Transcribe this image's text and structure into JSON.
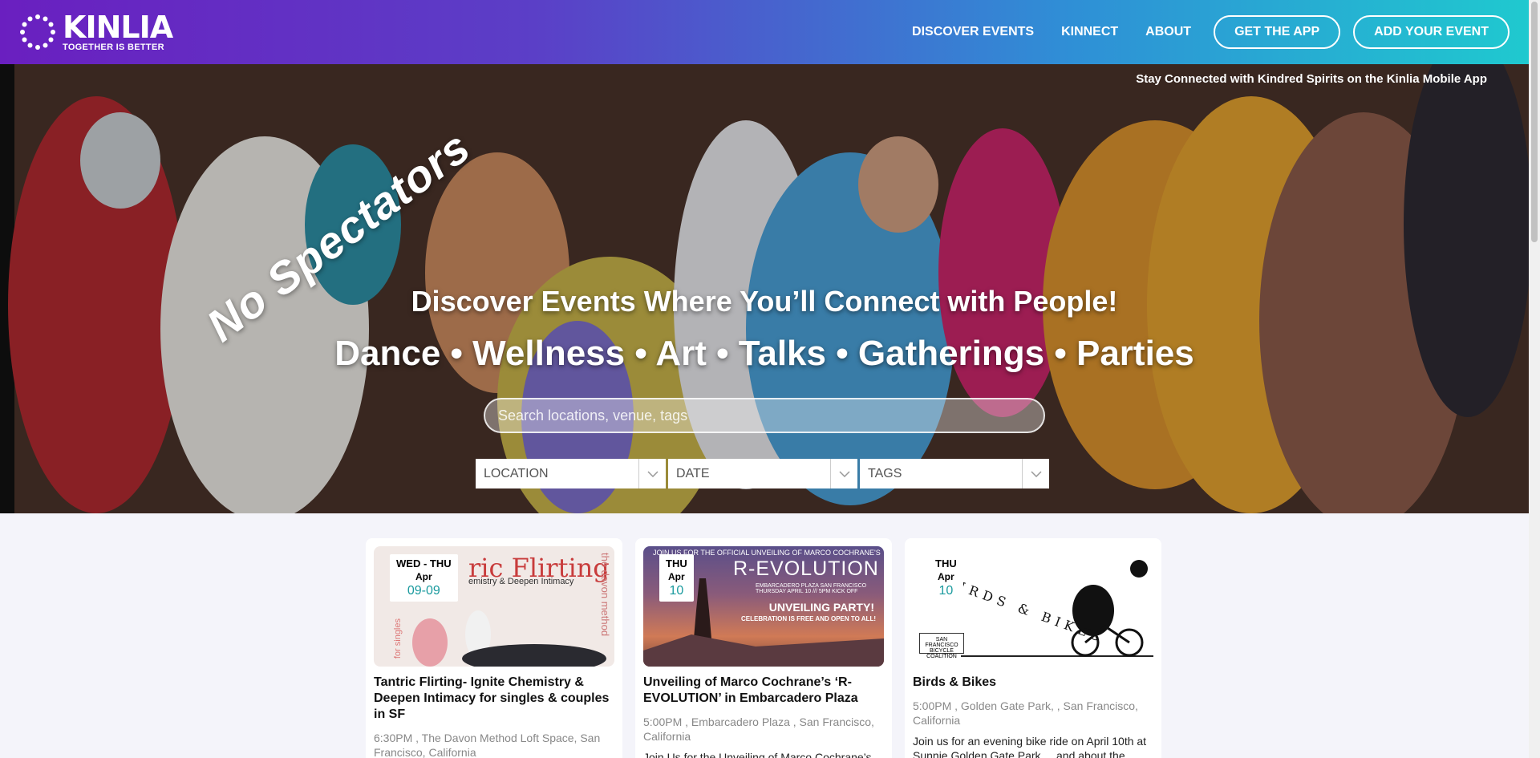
{
  "brand": {
    "name": "KINLIA",
    "tagline": "TOGETHER IS BETTER"
  },
  "nav": {
    "links": [
      "DISCOVER EVENTS",
      "KINNECT",
      "ABOUT"
    ],
    "get_app": "GET THE APP",
    "add_event": "ADD YOUR EVENT"
  },
  "hero": {
    "app_promo": "Stay Connected with Kindred Spirits on the Kinlia Mobile App",
    "slogan": "No Spectators",
    "headline": "Discover Events Where You’ll Connect with People!",
    "categories": "Dance • Wellness • Art • Talks • Gatherings • Parties",
    "search_placeholder": "Search locations, venue, tags",
    "filters": {
      "location": "LOCATION",
      "date": "DATE",
      "tags": "TAGS"
    }
  },
  "events": [
    {
      "badge_day": "WED - THU",
      "badge_month": "Apr",
      "badge_date": "09-09",
      "title": "Tantric Flirting- Ignite Chemistry & Deepen Intimacy for singles & couples in SF",
      "meta": "6:30PM , The Davon Method Loft Space, San Francisco, California",
      "image": {
        "big": "ric Flirting",
        "sub": "emistry & Deepen Intimacy",
        "side": "the davon method",
        "left": "for singles"
      }
    },
    {
      "badge_day": "THU",
      "badge_month": "Apr",
      "badge_date": "10",
      "title": "Unveiling of Marco Cochrane’s ‘R-EVOLUTION’ in Embarcadero Plaza",
      "meta": "5:00PM , Embarcadero Plaza , San Francisco, California",
      "desc": "Join Us for the Unveiling of Marco Cochrane’s",
      "image": {
        "top": "JOIN US FOR THE OFFICIAL UNVEILING OF MARCO COCHRANE'S",
        "big": "R-EVOLUTION",
        "line1": "EMBARCADERO PLAZA SAN FRANCISCO",
        "line2": "THURSDAY APRIL 10 /// 5PM KICK OFF",
        "party": "UNVEILING PARTY!",
        "free": "CELEBRATION IS FREE AND OPEN TO ALL!"
      }
    },
    {
      "badge_day": "THU",
      "badge_month": "Apr",
      "badge_date": "10",
      "title": "Birds & Bikes",
      "meta": "5:00PM , Golden Gate Park, , San Francisco, California",
      "desc": "Join us for an evening bike ride on April 10th at Sunnie Golden Gate Park ... and about the",
      "image": {
        "title": "BIRDS & BIKES",
        "logo": "SAN FRANCISCO BICYCLE COALITION"
      }
    }
  ],
  "colors": {
    "gradient_start": "#6a1fc0",
    "gradient_end": "#1fc9cf",
    "accent": "#1a9a9e"
  }
}
